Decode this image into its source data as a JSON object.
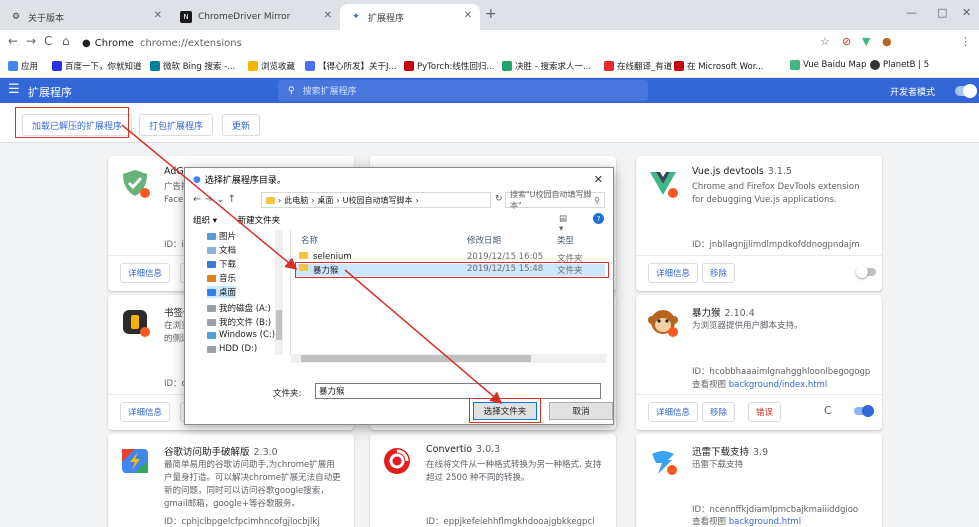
{
  "tabs": [
    {
      "label": "关于版本",
      "icon": "gear-icon"
    },
    {
      "label": "ChromeDriver Mirror",
      "icon": "npm-icon"
    },
    {
      "label": "扩展程序",
      "icon": "puzzle-icon"
    }
  ],
  "omnibox": {
    "site": "Chrome",
    "url": "chrome://extensions"
  },
  "bookmarks": [
    {
      "label": "应用",
      "color": "#4285f4"
    },
    {
      "label": "百度一下，你就知道",
      "color": "#2932e1"
    },
    {
      "label": "微软 Bing 搜索 -...",
      "color": "#00809d"
    },
    {
      "label": "浏览收藏",
      "color": "#f4b400"
    },
    {
      "label": "【得心所发】关于J...",
      "color": "#4d70f5"
    },
    {
      "label": "PyTorch:线性回归...",
      "color": "#c7000b"
    },
    {
      "label": "决胜 - 搜索求人一...",
      "color": "#22a56a"
    },
    {
      "label": "在线翻译_有道",
      "color": "#e52b2b"
    },
    {
      "label": "在 Microsoft Wor...",
      "color": "#c7000b"
    },
    {
      "label": "Vue Baidu Map",
      "color": "#41b883"
    },
    {
      "label": "PlanetB | 5",
      "color": "#333333"
    }
  ],
  "header": {
    "title": "扩展程序",
    "search_placeholder": "搜索扩展程序",
    "dev_mode_label": "开发者模式"
  },
  "actions": {
    "load_unpacked": "加载已解压的扩展程序",
    "pack": "打包扩展程序",
    "update": "更新"
  },
  "cards": [
    {
      "name": "AdGu",
      "version": "",
      "desc": "广告拦\nFaceb",
      "id": "ID：ig",
      "details": "详细信息",
      "remove": "移除",
      "enabled": false
    },
    {
      "name": "",
      "version": "",
      "desc": "",
      "id": "",
      "details": "",
      "remove": "",
      "enabled": false
    },
    {
      "name": "Vue.js devtools",
      "version": "3.1.5",
      "desc": "Chrome and Firefox DevTools extension for debugging Vue.js applications.",
      "id": "ID：jnbllagnjjlimdlmpdkofddnogpndajm",
      "details": "详细信息",
      "remove": "移除",
      "enabled": false
    },
    {
      "name": "书签侧",
      "version": "",
      "desc": "在浏览\n的侧边",
      "id": "ID：cp",
      "details": "详细信息",
      "remove": "移除",
      "enabled": true
    },
    {
      "name": "",
      "version": "",
      "desc": "",
      "id": "",
      "details": "",
      "remove": "",
      "enabled": true
    },
    {
      "name": "暴力猴",
      "version": "2.10.4",
      "desc": "为浏览器提供用户脚本支持。",
      "id": "ID：hcobbhaaaimlgnahgghloonlbegogogp",
      "view_label": "查看视图",
      "view_link": "background/index.html",
      "details": "详细信息",
      "remove": "移除",
      "error": "错误",
      "enabled": true
    },
    {
      "name": "谷歌访问助手破解版",
      "version": "2.3.0",
      "desc": "最简单易用的谷歌访问助手,为chrome扩展用户量身打造。可以解决chrome扩展无法自动更新的问题，同时可以访问谷歌google搜索，gmail邮箱，google+等谷歌服务。",
      "id": "ID：cphjclbpgelcfpcimhncofgjlocbjlkj"
    },
    {
      "name": "Convertio",
      "version": "3.0.3",
      "desc": "在线将文件从一种格式转换为另一种格式. 支持超过 2500 种不同的转换。",
      "id": "ID：eppjkefeiehhflmgkhdooajgbkkegpcl"
    },
    {
      "name": "迅雷下载支持",
      "version": "3.9",
      "desc": "迅雷下载支持",
      "id": "ID：ncennffkjdiamlpmcbajkmaiiiddgioo",
      "view_label": "查看视图",
      "view_link": "background.html"
    }
  ],
  "dialog": {
    "title": "选择扩展程序目录。",
    "path": [
      "此电脑",
      "桌面",
      "U校园自动填写脚本"
    ],
    "search_placeholder": "搜索\"U校园自动填写脚本\"",
    "organize": "组织 ▾",
    "new_folder": "新建文件夹",
    "tree": [
      "图片",
      "文档",
      "下载",
      "音乐",
      "桌面",
      "我的磁盘 (A:)",
      "我的文件 (B:)",
      "Windows (C:)",
      "HDD (D:)"
    ],
    "columns": {
      "name": "名称",
      "date": "修改日期",
      "type": "类型"
    },
    "files": [
      {
        "name": "selenium",
        "date": "2019/12/15 16:05",
        "type": "文件夹"
      },
      {
        "name": "暴力猴",
        "date": "2019/12/15 15:48",
        "type": "文件夹"
      }
    ],
    "filename_label": "文件夹:",
    "filename_value": "暴力猴",
    "select_button": "选择文件夹",
    "cancel_button": "取消"
  }
}
